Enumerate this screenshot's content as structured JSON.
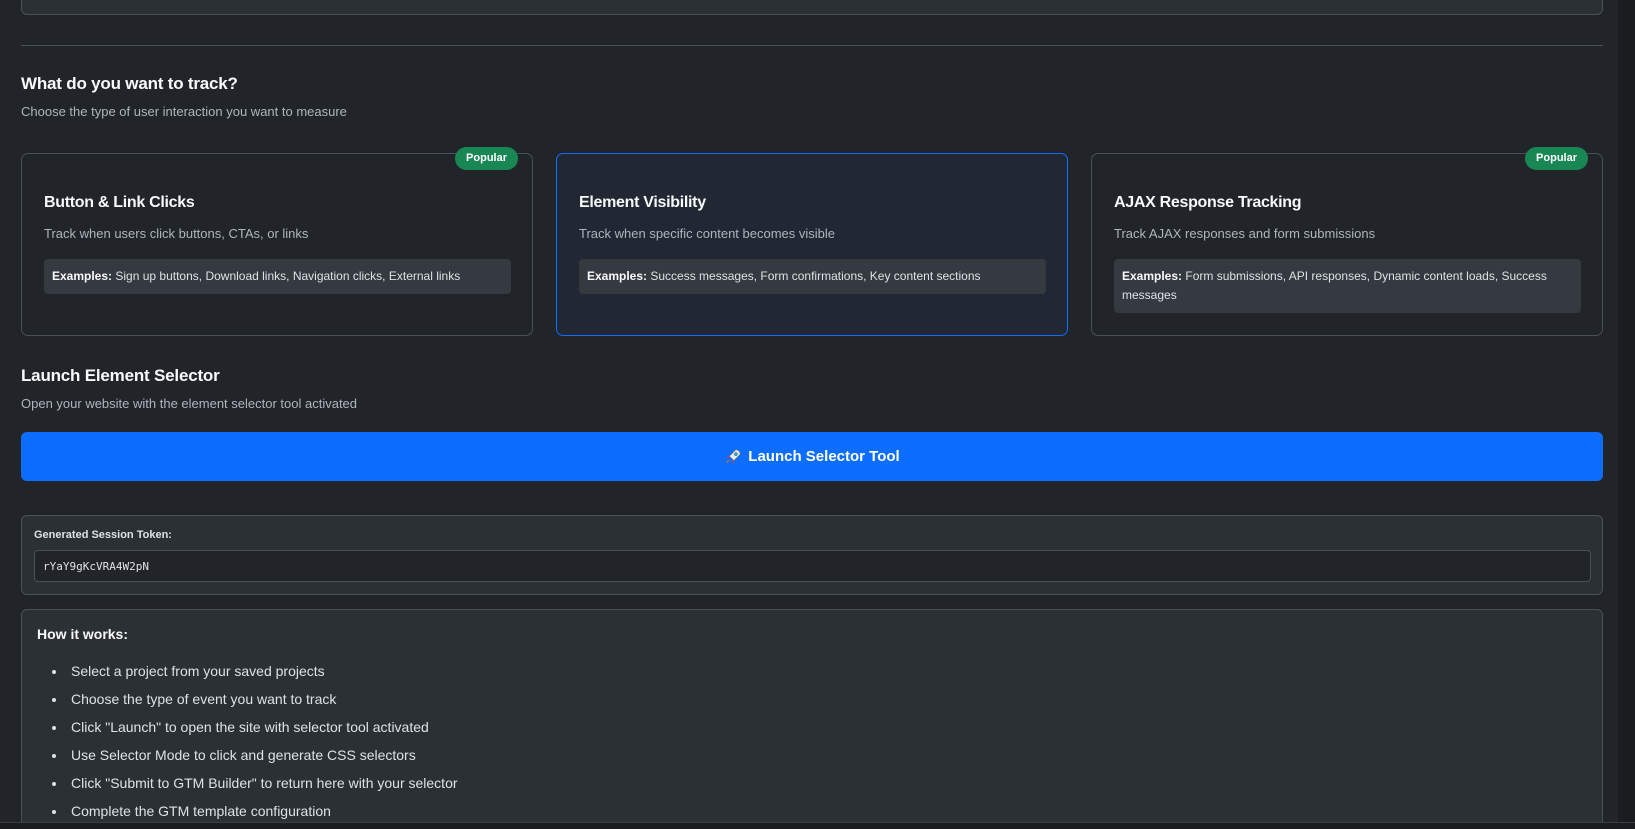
{
  "section": {
    "title": "What do you want to track?",
    "subtitle": "Choose the type of user interaction you want to measure"
  },
  "cards": [
    {
      "title": "Button & Link Clicks",
      "description": "Track when users click buttons, CTAs, or links",
      "examples_label": "Examples:",
      "examples": "Sign up buttons, Download links, Navigation clicks, External links",
      "badge": "Popular"
    },
    {
      "title": "Element Visibility",
      "description": "Track when specific content becomes visible",
      "examples_label": "Examples:",
      "examples": "Success messages, Form confirmations, Key content sections"
    },
    {
      "title": "AJAX Response Tracking",
      "description": "Track AJAX responses and form submissions",
      "examples_label": "Examples:",
      "examples": "Form submissions, API responses, Dynamic content loads, Success messages",
      "badge": "Popular"
    }
  ],
  "launch": {
    "title": "Launch Element Selector",
    "subtitle": "Open your website with the element selector tool activated",
    "button_label": "Launch Selector Tool",
    "button_icon": "rocket-icon"
  },
  "token": {
    "label": "Generated Session Token:",
    "value": "rYaY9gKcVRA4W2pN"
  },
  "how_it_works": {
    "title": "How it works:",
    "steps": [
      "Select a project from your saved projects",
      "Choose the type of event you want to track",
      "Click \"Launch\" to open the site with selector tool activated",
      "Use Selector Mode to click and generate CSS selectors",
      "Click \"Submit to GTM Builder\" to return here with your selector",
      "Complete the GTM template configuration"
    ]
  },
  "colors": {
    "background": "#212529",
    "accent": "#0d6efd",
    "badge": "#198754"
  }
}
